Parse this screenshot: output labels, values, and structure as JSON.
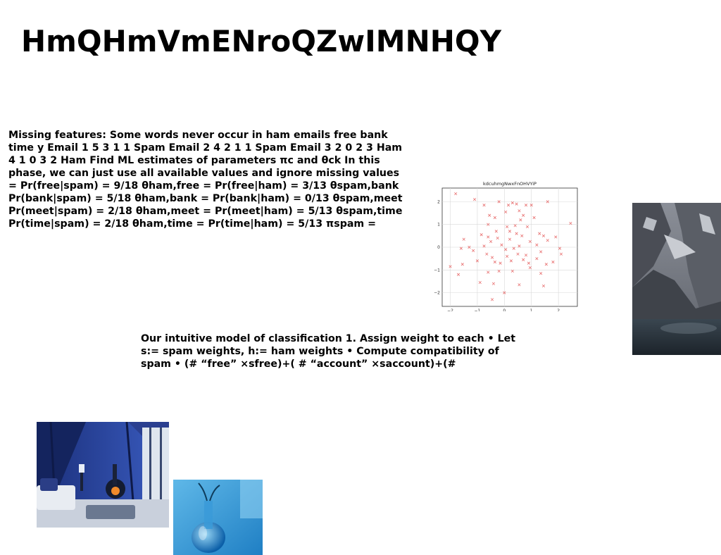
{
  "slide": {
    "title": "HmQHmVmENroQZwIMNHQY",
    "paragraph_1": "Missing features: Some words never occur in ham emails free bank time y Email 1 5 3 1 1 Spam Email 2 4 2 1 1 Spam Email 3 2 0 2 3 Ham 4 1 0 3 2 Ham Find ML estimates of parameters πc and θck In this phase, we can just use all available values and ignore missing values = Pr(free|spam) = 9/18 θham,free = Pr(free|ham) = 3/13 θspam,bank Pr(bank|spam) = 5/18 θham,bank = Pr(bank|ham) = 0/13 θspam,meet Pr(meet|spam) = 2/18 θham,meet = Pr(meet|ham) = 5/13 θspam,time Pr(time|spam) = 2/18 θham,time = Pr(time|ham) = 5/13 πspam =",
    "paragraph_2": "Our intuitive model of classification 1. Assign weight to each • Let s:= spam weights, h:= ham weights • Compute compatibility of spam • (# “free” ×sfree)+( # “account” ×saccount)+(#"
  },
  "chart_data": {
    "type": "scatter",
    "title": "kdcuhmgNwxFnOHVYiP",
    "xlabel": "",
    "ylabel": "",
    "xlim": [
      -2.3,
      2.7
    ],
    "ylim": [
      -2.6,
      2.6
    ],
    "xticks": [
      -2,
      -1,
      0,
      1,
      2
    ],
    "yticks": [
      -2,
      -1,
      0,
      1,
      2
    ],
    "grid": true,
    "marker": "x",
    "color": "#e87070",
    "points": [
      [
        -1.8,
        2.35
      ],
      [
        -1.1,
        2.1
      ],
      [
        -0.2,
        2.0
      ],
      [
        0.3,
        1.95
      ],
      [
        0.45,
        1.9
      ],
      [
        0.8,
        1.85
      ],
      [
        1.0,
        1.85
      ],
      [
        1.6,
        2.0
      ],
      [
        -0.75,
        1.85
      ],
      [
        -0.55,
        1.4
      ],
      [
        -0.35,
        1.3
      ],
      [
        0.15,
        1.85
      ],
      [
        0.55,
        1.6
      ],
      [
        0.7,
        1.4
      ],
      [
        0.6,
        1.2
      ],
      [
        1.1,
        1.3
      ],
      [
        2.45,
        1.05
      ],
      [
        -0.6,
        1.0
      ],
      [
        0.1,
        0.9
      ],
      [
        0.4,
        0.95
      ],
      [
        0.85,
        0.9
      ],
      [
        1.3,
        0.6
      ],
      [
        1.45,
        0.5
      ],
      [
        1.9,
        0.45
      ],
      [
        -1.5,
        0.35
      ],
      [
        -0.6,
        0.45
      ],
      [
        -0.25,
        0.4
      ],
      [
        0.2,
        0.7
      ],
      [
        0.45,
        0.6
      ],
      [
        0.65,
        0.5
      ],
      [
        0.95,
        0.25
      ],
      [
        1.2,
        0.1
      ],
      [
        -1.3,
        0.0
      ],
      [
        -0.75,
        0.05
      ],
      [
        -0.5,
        0.25
      ],
      [
        -0.1,
        0.1
      ],
      [
        0.05,
        -0.1
      ],
      [
        0.35,
        -0.05
      ],
      [
        0.55,
        0.05
      ],
      [
        2.05,
        -0.05
      ],
      [
        -1.6,
        -0.05
      ],
      [
        -1.15,
        -0.15
      ],
      [
        -0.65,
        -0.3
      ],
      [
        -0.45,
        -0.45
      ],
      [
        0.1,
        -0.4
      ],
      [
        0.5,
        -0.3
      ],
      [
        0.8,
        -0.35
      ],
      [
        1.35,
        -0.2
      ],
      [
        -2.0,
        -0.85
      ],
      [
        -1.55,
        -0.75
      ],
      [
        -1.0,
        -0.6
      ],
      [
        -0.35,
        -0.65
      ],
      [
        0.25,
        -0.6
      ],
      [
        0.7,
        -0.55
      ],
      [
        1.55,
        -0.75
      ],
      [
        2.1,
        -0.3
      ],
      [
        -1.7,
        -1.2
      ],
      [
        -0.6,
        -1.1
      ],
      [
        -0.2,
        -1.05
      ],
      [
        0.3,
        -1.05
      ],
      [
        0.95,
        -0.9
      ],
      [
        1.35,
        -1.15
      ],
      [
        1.8,
        -0.65
      ],
      [
        -0.9,
        -1.55
      ],
      [
        -0.4,
        -1.6
      ],
      [
        0.0,
        -2.0
      ],
      [
        0.55,
        -1.65
      ],
      [
        1.45,
        -1.7
      ],
      [
        -0.45,
        -2.3
      ],
      [
        1.2,
        -0.5
      ],
      [
        0.9,
        -0.7
      ],
      [
        -0.15,
        -0.7
      ],
      [
        0.2,
        0.35
      ],
      [
        -0.3,
        0.7
      ],
      [
        1.6,
        0.3
      ],
      [
        -0.85,
        0.55
      ],
      [
        0.05,
        1.55
      ]
    ]
  },
  "images": [
    {
      "name": "mountain-photo",
      "description": ""
    },
    {
      "name": "cabin-living-room-photo",
      "description": ""
    },
    {
      "name": "blue-vase-photo",
      "description": ""
    }
  ]
}
